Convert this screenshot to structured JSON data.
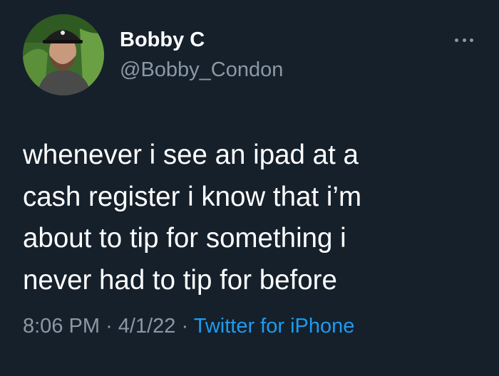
{
  "user": {
    "name": "Bobby C",
    "handle": "@Bobby_Condon"
  },
  "tweet": {
    "text": "whenever i see an ipad at a\ncash register i know that i’m\nabout to tip for something i\nnever had to tip for before"
  },
  "meta": {
    "time": "8:06 PM",
    "separator": "·",
    "date": "4/1/22",
    "source": "Twitter for iPhone"
  },
  "icons": {
    "more": "more-horizontal-icon"
  },
  "colors": {
    "background": "#15202b",
    "primary_text": "#ffffff",
    "secondary_text": "#8b98a5",
    "accent": "#1d9bf0"
  }
}
